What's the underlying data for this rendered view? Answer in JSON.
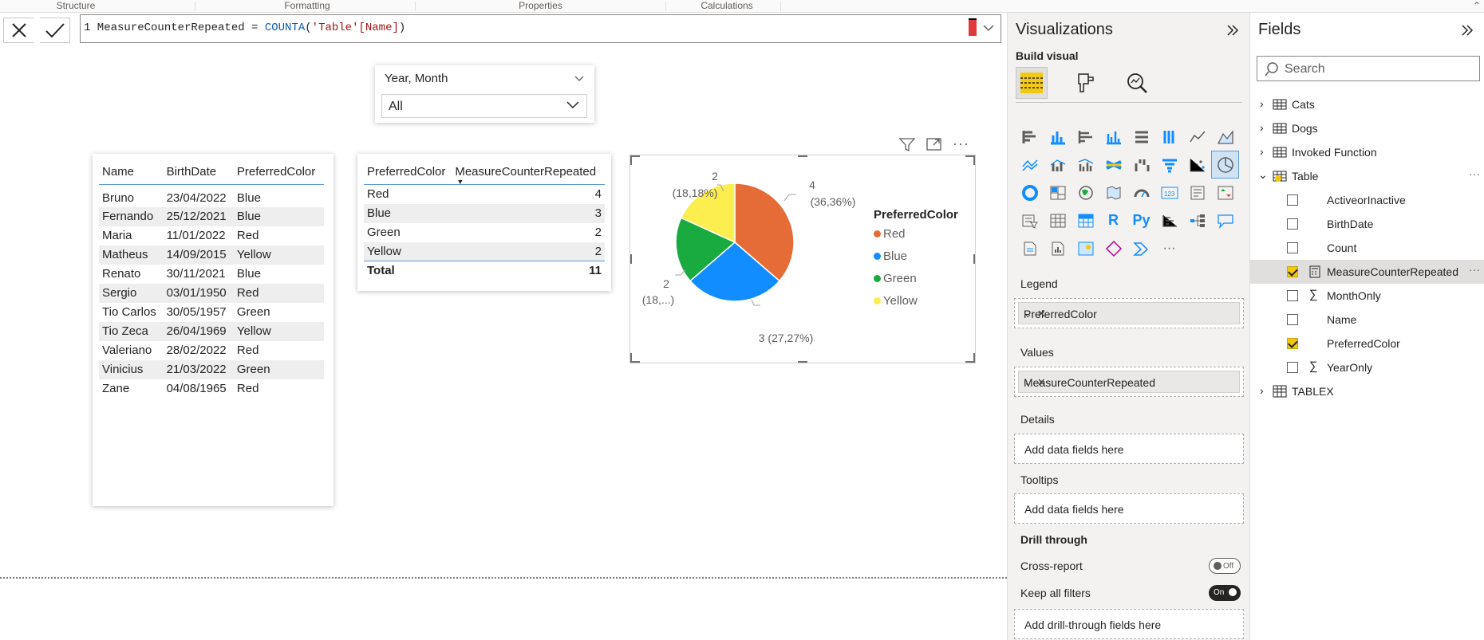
{
  "ribbon": {
    "groups": [
      "Structure",
      "Formatting",
      "Properties",
      "Calculations"
    ]
  },
  "formula": {
    "line_number": "1",
    "text_prefix": " MeasureCounterRepeated = ",
    "function": "COUNTA",
    "open": "(",
    "argument": "'Table'[Name]",
    "close": ")"
  },
  "slicer": {
    "title": "Year, Month",
    "selected": "All"
  },
  "table1": {
    "columns": [
      "Name",
      "BirthDate",
      "PreferredColor"
    ],
    "rows": [
      [
        "Bruno",
        "23/04/2022",
        "Blue"
      ],
      [
        "Fernando",
        "25/12/2021",
        "Blue"
      ],
      [
        "Maria",
        "11/01/2022",
        "Red"
      ],
      [
        "Matheus",
        "14/09/2015",
        "Yellow"
      ],
      [
        "Renato",
        "30/11/2021",
        "Blue"
      ],
      [
        "Sergio",
        "03/01/1950",
        "Red"
      ],
      [
        "Tio Carlos",
        "30/05/1957",
        "Green"
      ],
      [
        "Tio Zeca",
        "26/04/1969",
        "Yellow"
      ],
      [
        "Valeriano",
        "28/02/2022",
        "Red"
      ],
      [
        "Vinicius",
        "21/03/2022",
        "Green"
      ],
      [
        "Zane",
        "04/08/1965",
        "Red"
      ]
    ]
  },
  "table2": {
    "columns": [
      "PreferredColor",
      "MeasureCounterRepeated"
    ],
    "rows": [
      [
        "Red",
        "4"
      ],
      [
        "Blue",
        "3"
      ],
      [
        "Green",
        "2"
      ],
      [
        "Yellow",
        "2"
      ]
    ],
    "total_label": "Total",
    "total_value": "11"
  },
  "chart_data": {
    "type": "pie",
    "legend_title": "PreferredColor",
    "legend_position": "right",
    "slices": [
      {
        "name": "Red",
        "value": 4,
        "label_value": "4",
        "label_pct": "(36,36%)",
        "color": "#e66c37"
      },
      {
        "name": "Blue",
        "value": 3,
        "label_value": "3 (27,27%)",
        "label_pct": "",
        "color": "#118dff"
      },
      {
        "name": "Green",
        "value": 2,
        "label_value": "2",
        "label_pct": "(18,...)",
        "color": "#1aab40"
      },
      {
        "name": "Yellow",
        "value": 2,
        "label_value": "2",
        "label_pct": "(18,18%)",
        "color": "#fcee4f"
      }
    ]
  },
  "visualizations": {
    "title": "Visualizations",
    "build_visual": "Build visual",
    "legend_label": "Legend",
    "legend_field": "PreferredColor",
    "values_label": "Values",
    "values_field": "MeasureCounterRepeated",
    "details_label": "Details",
    "details_placeholder": "Add data fields here",
    "tooltips_label": "Tooltips",
    "tooltips_placeholder": "Add data fields here",
    "drill_label": "Drill through",
    "cross_report": "Cross-report",
    "cross_report_state": "Off",
    "keep_filters": "Keep all filters",
    "keep_filters_state": "On",
    "drill_placeholder": "Add drill-through fields here",
    "r_icon_text": "R",
    "py_icon_text": "Py",
    "kpi_icon_text": "123"
  },
  "fields": {
    "title": "Fields",
    "search_placeholder": "Search",
    "tables": [
      "Cats",
      "Dogs",
      "Invoked Function",
      "Table",
      "TABLEX"
    ],
    "table_fields": [
      {
        "name": "ActiveorInactive",
        "checked": false,
        "sigma": false
      },
      {
        "name": "BirthDate",
        "checked": false,
        "sigma": false
      },
      {
        "name": "Count",
        "checked": false,
        "sigma": false
      },
      {
        "name": "MeasureCounterRepeated",
        "checked": true,
        "sigma": false
      },
      {
        "name": "MonthOnly",
        "checked": false,
        "sigma": true
      },
      {
        "name": "Name",
        "checked": false,
        "sigma": false
      },
      {
        "name": "PreferredColor",
        "checked": true,
        "sigma": false
      },
      {
        "name": "YearOnly",
        "checked": false,
        "sigma": true
      }
    ]
  },
  "colors": {
    "accent_yellow": "#f2c811",
    "table_rule": "#5b9bd5"
  }
}
